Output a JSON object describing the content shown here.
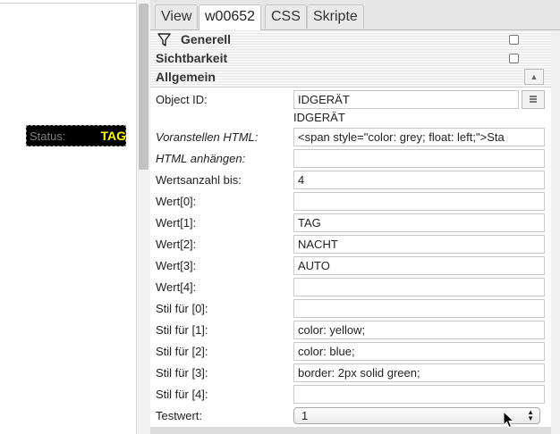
{
  "canvas": {
    "widget": {
      "prepend": "Status:",
      "value": "TAG",
      "value_color": "#ffff00",
      "prepend_color": "#808080"
    }
  },
  "tabs": [
    {
      "label": "View",
      "active": false
    },
    {
      "label": "w00652",
      "active": true
    },
    {
      "label": "CSS",
      "active": false
    },
    {
      "label": "Skripte",
      "active": false
    }
  ],
  "sections": {
    "generell": "Generell",
    "sichtbarkeit": "Sichtbarkeit",
    "allgemein": "Allgemein"
  },
  "fields": {
    "object_id": {
      "label": "Object ID:",
      "value": "IDGERÄT",
      "resolved_name": "IDGERÄT"
    },
    "prepend_html": {
      "label": "Voranstellen HTML:",
      "value": "<span style=\"color: grey; float: left;\">Sta"
    },
    "append_html": {
      "label": "HTML anhängen:",
      "value": ""
    },
    "count": {
      "label": "Wertsanzahl bis:",
      "value": "4"
    },
    "values": [
      {
        "label": "Wert[0]:",
        "value": ""
      },
      {
        "label": "Wert[1]:",
        "value": "TAG"
      },
      {
        "label": "Wert[2]:",
        "value": "NACHT"
      },
      {
        "label": "Wert[3]:",
        "value": "AUTO"
      },
      {
        "label": "Wert[4]:",
        "value": ""
      }
    ],
    "styles": [
      {
        "label": "Stil für [0]:",
        "value": ""
      },
      {
        "label": "Stil für [1]:",
        "value": "color: yellow;"
      },
      {
        "label": "Stil für [2]:",
        "value": "color: blue;"
      },
      {
        "label": "Stil für [3]:",
        "value": "border: 2px solid green;"
      },
      {
        "label": "Stil für [4]:",
        "value": ""
      }
    ],
    "test_value": {
      "label": "Testwert:",
      "value": "1"
    }
  },
  "icons": {
    "filter": "filter-icon",
    "collapse": "triangle-up-icon",
    "object_browser": "list-icon",
    "select_arrows": "up-down-arrows-icon",
    "cursor": "mouse-pointer-icon"
  }
}
